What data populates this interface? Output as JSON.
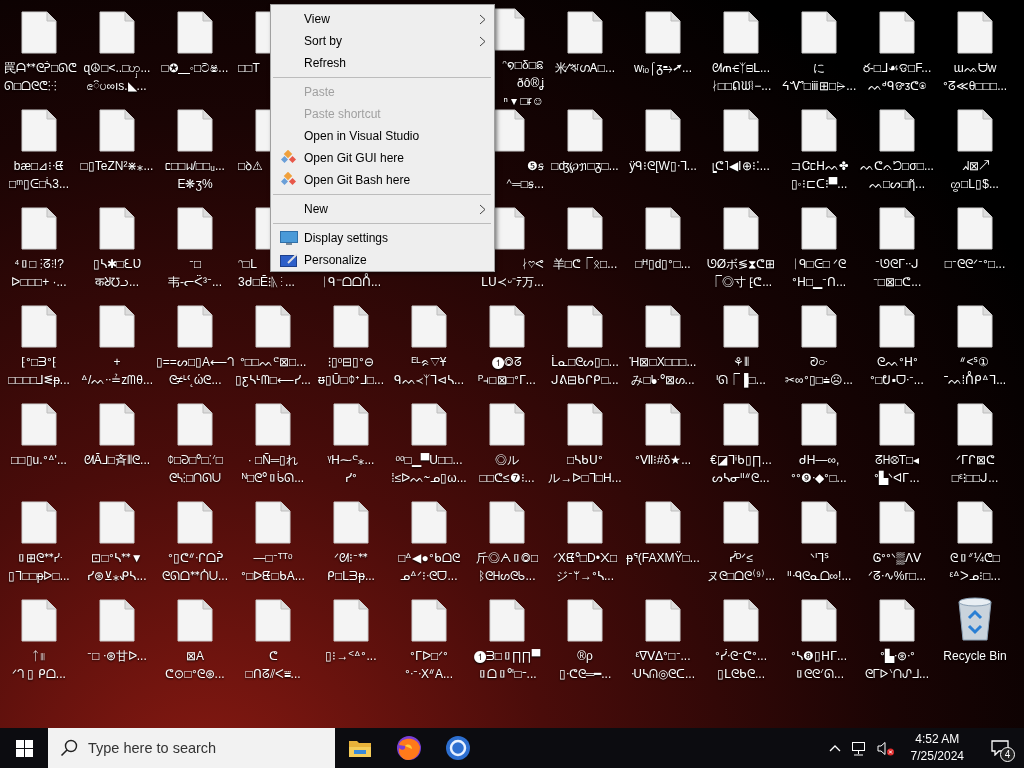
{
  "desktop": {
    "rows": [
      [
        {
          "kind": "file-left",
          "lines": [
            "罠ᗩᕯᘓᕉ□ᘏᕦ",
            "ᘏ□ᗝᘓᕦ⁝ᐧ⁝"
          ]
        },
        {
          "kind": "file",
          "lines": [
            "ɋ☮□<..□ၯ...",
            "ၕ៝ပ∞ıs.◣..."
          ]
        },
        {
          "kind": "file",
          "lines": [
            "□✪▁◦□ටෂ..."
          ]
        },
        {
          "kind": "file-left",
          "lines": [
            "□□T"
          ]
        },
        {
          "kind": "hidden"
        },
        {
          "kind": "hidden"
        },
        {
          "kind": "file-right",
          "lines": [
            "ᵔ໑□δ□ଛ",
            "ðô®ʝ",
            "ⁿ ▾ □ᵲ☺"
          ]
        },
        {
          "kind": "file",
          "lines": [
            "米∕ঋഗᎪ□..."
          ]
        },
        {
          "kind": "file",
          "lines": [
            "wᵢₒ⌠ᵹ⥱➚..."
          ]
        },
        {
          "kind": "file",
          "lines": [
            "ᘛጠ⋲ᛉ⊟ᒪ...",
            "ᛅ□□ᕠᙎ⦚−..."
          ]
        },
        {
          "kind": "file",
          "lines": [
            "に",
            "ᔦᏉ□ⅲ⊞□⩥..."
          ]
        },
        {
          "kind": "file",
          "lines": [
            "ర-□ᒧ☙ଡ□F...",
            "ᨓᒄᑫଙᴣᕦ⍟"
          ]
        },
        {
          "kind": "file",
          "lines": [
            "ɯᨕᗨw",
            "ᐤᘔ≪θ□□□..."
          ]
        }
      ],
      [
        {
          "kind": "file",
          "lines": [
            "bæ□⊿⁝ᐧᘀ",
            "□ᵐ▯ᕮ□ᓵ3..."
          ]
        },
        {
          "kind": "file",
          "lines": [
            "□▯TeZN²⋇⁎..."
          ]
        },
        {
          "kind": "file",
          "lines": [
            "ᥴ□□ᥕ/□□ᵤ...",
            "E❋ʒ%"
          ]
        },
        {
          "kind": "file-left",
          "lines": [
            "□ꝺ⚠"
          ]
        },
        {
          "kind": "hidden"
        },
        {
          "kind": "hidden"
        },
        {
          "kind": "file-right",
          "lines": [
            "❺ꞩ",
            "ᣔ═□ꞩ..."
          ]
        },
        {
          "kind": "file",
          "lines": [
            "□ʤ℘ᥟ□ᵹ□..."
          ]
        },
        {
          "kind": "file",
          "lines": [
            "ӱᑫ⁝ᘓ[W▯ᐧᒣ..."
          ]
        },
        {
          "kind": "file",
          "lines": [
            "ᥧᕦ˥◀Ⅰ⊕⁝⁚..."
          ]
        },
        {
          "kind": "file",
          "lines": [
            "コᏣᥴᕼᨓ✤",
            "▯◦⁝⊏ᑕ⁝▀..."
          ]
        },
        {
          "kind": "file",
          "lines": [
            "ᨓᕦᨊᘤ□σ□...",
            "ᨓ□ᔕ□ῆ..."
          ]
        },
        {
          "kind": "file",
          "lines": [
            "ᖽ⊠↗",
            "ᦛ□ᒪ▯$..."
          ]
        }
      ],
      [
        {
          "kind": "file",
          "lines": [
            "⁴▯□ ⁝ᘔ⫶!?",
            "ᐅ□□□+ ·..."
          ]
        },
        {
          "kind": "file",
          "lines": [
            "▯ᓴ✱□ᘍƲ",
            "कᖈ℧ᓗ..."
          ]
        },
        {
          "kind": "file",
          "lines": [
            "ᐨ□",
            "韦-ᓕᑈ³ᐨ..."
          ]
        },
        {
          "kind": "file-left",
          "lines": [
            "ᵔ□ᒪ",
            "3ᑯ□Ē⁝ᚣ⁝..."
          ]
        },
        {
          "kind": "file-lower",
          "lines": [
            "ᛁᑫ⁻ᗝᗝᑍ..."
          ]
        },
        {
          "kind": "hidden"
        },
        {
          "kind": "file-right",
          "lines": [
            "ᛅ♡ᕙ",
            "ᒪᑌ≺ᵕ⁻ﾃ万..."
          ]
        },
        {
          "kind": "file",
          "lines": [
            "羊□ᕦ⎾ᛟ□..."
          ]
        },
        {
          "kind": "file",
          "lines": [
            "□ᴴ▯d▯ᐤ□..."
          ]
        },
        {
          "kind": "file",
          "lines": [
            "ᘎØボ≶⧗ᕦ⊞",
            "⎾◎寸 ⁅ᕦ..."
          ]
        },
        {
          "kind": "file",
          "lines": [
            "ᛁᑫ□ᕮ□ ᐟᘓ",
            "ᐤᕼ□▁ᐨᑎ..."
          ]
        },
        {
          "kind": "file",
          "lines": [
            "ᐨᘎᘓᒥᐧᐧᒍ",
            "ᐨ□⊠□ᕦ..."
          ]
        },
        {
          "kind": "file",
          "lines": [
            "□ᐨᘓᘓᐟᐨᐤ□..."
          ]
        }
      ],
      [
        {
          "kind": "file",
          "lines": [
            "⁅ᐤ□ᗱᐤ⁅",
            "□□□□⅃ᓬᵽ..."
          ]
        },
        {
          "kind": "file",
          "lines": [
            "+",
            "ᐞ/ᨓᐧᐧ≟zᗰθ..."
          ]
        },
        {
          "kind": "file",
          "lines": [
            "▯==ᔕ□▯A⟵ᘃ",
            "ᘓ≠ᒻᒼ˛ώᘓ..."
          ]
        },
        {
          "kind": "file",
          "lines": [
            "ᐤ□□ᨓᕪ⊠□...",
            "▯ƹᓴᒻᗰ□⟵ᓯ..."
          ]
        },
        {
          "kind": "file",
          "lines": [
            "⁝▯ᵒ⊟▯ᐤ⊖",
            "ᵿ▯Ū□ᛰᕀᒧ□..."
          ]
        },
        {
          "kind": "file",
          "lines": [
            "ᴱᴸᨑ▽Ұ",
            "ᑫᨓ≺ᛉᒣ⊲ᓴ..."
          ]
        },
        {
          "kind": "file",
          "lines": [
            "❶◎ᘔ",
            "ᴾ⫞□⊠□ᐤᒥ..."
          ]
        },
        {
          "kind": "file",
          "lines": [
            "ᒫᓇ□ᘓᔕ▯□...",
            "ᒍᕕ⊟ᑲᒋᑭ□..."
          ]
        },
        {
          "kind": "file",
          "lines": [
            "Ἡ⊠□X□□□...",
            "み□ᖲᐧᐤ⊠ᔕ..."
          ]
        },
        {
          "kind": "file",
          "lines": [
            "⚘⦀",
            "ᑊᘏ⎾▐□..."
          ]
        },
        {
          "kind": "file",
          "lines": [
            "ᘑ○ᐧ",
            "✂∞ᐤ▯□⩧☹..."
          ]
        },
        {
          "kind": "file",
          "lines": [
            "ᘓᨓᐤᕼᐤ",
            "ᐤ□ᕞ▪ᗜᐧᐨ..."
          ]
        },
        {
          "kind": "file",
          "lines": [
            "ᐥ<ᔆ①",
            "⁻ᨓ⁞ᑍᑭᐞᒣ..."
          ]
        }
      ],
      [
        {
          "kind": "file",
          "lines": [
            "□□▯u.ᐤᐞ'..."
          ]
        },
        {
          "kind": "file",
          "lines": [
            "ᘛĀ⅃□斉⦀ᘓ..."
          ]
        },
        {
          "kind": "file",
          "lines": [
            "ᛰ□ᘒ□ᐤ□⁚ᐟ□",
            "ᘓᓴ⁝□ᑎᘏᑌ"
          ]
        },
        {
          "kind": "file",
          "lines": [
            "· □Ñ═▯れ",
            "ᴺ□ᘓᐤ▯ᑳᘏ..."
          ]
        },
        {
          "kind": "file",
          "lines": [
            "ᵞᕼ⁓ᕪ⁎...",
            "ᓯᐤ"
          ]
        },
        {
          "kind": "file",
          "lines": [
            "ᵒᵒ□▁▀U□□...",
            "⁞≤ᐅᨓ⁓ᓄ▯ω..."
          ]
        },
        {
          "kind": "file",
          "lines": [
            "◎ル",
            "□□ᕦ≤❼⁝..."
          ]
        },
        {
          "kind": "file",
          "lines": [
            "□ᓴᑲᑌᐤ",
            "ル→ᐅ□ᒣ□H..."
          ]
        },
        {
          "kind": "file",
          "lines": [
            "ᐤⅦ⁝#δ★..."
          ]
        },
        {
          "kind": "file",
          "lines": [
            "€◪ᒣⁱᑲ▯∏...",
            "ᔕᓴᓂᐦᐥᘓ..."
          ]
        },
        {
          "kind": "file",
          "lines": [
            "ᑯH—∞,",
            "ᐤᐤ❾ᐧ◆ᐤ□..."
          ]
        },
        {
          "kind": "file",
          "lines": [
            "ᘔᕼ⊗T□◂",
            "ᐤ▙ᐠᐊᒥ..."
          ]
        },
        {
          "kind": "file",
          "lines": [
            "ᐟᒥᒋ⊠ᕦ",
            "□ᵋ⁝□□ᒍ..."
          ]
        }
      ],
      [
        {
          "kind": "file",
          "lines": [
            "▯⊞ᘓᕯᓯᐧ",
            "▯ᒣ□□ᵽᐅ□..."
          ]
        },
        {
          "kind": "file",
          "lines": [
            "⊡□ᐤᓴᕯ▼",
            "ᓯ⊛⊻⁎ᕵᓴ..."
          ]
        },
        {
          "kind": "file",
          "lines": [
            "ᐤ▯ᕦᐥᐧᒋᗝᕉ",
            "ᘓᘏᗝᕯᑍᑌ..."
          ]
        },
        {
          "kind": "file",
          "lines": [
            "—□ᐨᵀᵀᵒ",
            "ᐤ□ᐅᘀ□ᑲA..."
          ]
        },
        {
          "kind": "file",
          "lines": [
            "ᐟᘛ⁝ᐨᕯ",
            "ᑭ□ᒪᗱᵽ..."
          ]
        },
        {
          "kind": "file",
          "lines": [
            "□ᐞ◀●ᐤᑲᗝᘓ",
            "ᓄᐞᐟ⁝ᐧᘓᗜ..."
          ]
        },
        {
          "kind": "file",
          "lines": [
            "斤◎ᗅ▯◎□",
            "ᛒᘓᕼᔕᘓᑲ..."
          ]
        },
        {
          "kind": "file",
          "lines": [
            "ᐟXᘀᐤ□D•᙭□",
            "ジᐨᛘ→ᐤᓴ..."
          ]
        },
        {
          "kind": "file",
          "lines": [
            "ᵽᕐ(FAXMŸ□..."
          ]
        },
        {
          "kind": "file",
          "lines": [
            "ᓰᴰᐟ≤",
            "ヌᘓ□ᗝᘓ⁽⁹⁾..."
          ]
        },
        {
          "kind": "file",
          "lines": [
            "ᐠᑊᒣᔆ",
            "ᐦᑴᘓᓇᗝ∞!..."
          ]
        },
        {
          "kind": "file",
          "lines": [
            "Ꮆᐤᐤᐠ▒ᐱᐯ",
            "ᐟᘔᐧ∿%ᴦ□..."
          ]
        },
        {
          "kind": "file",
          "lines": [
            "ᘓ▯ᐥ¼ᕦ□",
            "ᵋᐞᐳᓄ⁝□..."
          ]
        }
      ],
      [
        {
          "kind": "file",
          "lines": [
            "ᛏ⦀",
            "ᐟᘃ ▯ ᑭᗝ..."
          ]
        },
        {
          "kind": "file",
          "lines": [
            "ᐨ□ ᐧ⊛甘ᐅ..."
          ]
        },
        {
          "kind": "file",
          "lines": [
            "⊠A",
            "ᕦ⊙□ᐤᘓ⊛..."
          ]
        },
        {
          "kind": "file",
          "lines": [
            "ᕦ",
            "□ᑎᘔ⫽ᐸ⩸..."
          ]
        },
        {
          "kind": "file",
          "lines": [
            "▯⁝→ᑉᐞᐤ..."
          ]
        },
        {
          "kind": "file",
          "lines": [
            "ᐤᒥᐅ□ᐟᐤ",
            "ᐤᐧᐨᐧXᐥA..."
          ]
        },
        {
          "kind": "file",
          "lines": [
            "❶ᗱ□▯∏∏▀",
            "▯ᗝ▯ᐤᑊ□ᐨ..."
          ]
        },
        {
          "kind": "file",
          "lines": [
            "®ρ",
            "▯ᐧᕦᘓ═━..."
          ]
        },
        {
          "kind": "file",
          "lines": [
            "ᵋᐁᐯᐃᐤ□ᐨ...",
            "ᑗᓴᕬ◎ᘓᑕ..."
          ]
        },
        {
          "kind": "file",
          "lines": [
            "ᐤᓰᐧᘓᐨᕦᐤ...",
            "▯ᒪᘓᑲᘓ..."
          ]
        },
        {
          "kind": "file",
          "lines": [
            "ᐤᓴ❽▯ᕼᒥ...",
            "▯ᘓᘓᐟᘏ..."
          ]
        },
        {
          "kind": "file",
          "lines": [
            "ᐤ▙ᐧ⊛ᐧᐤ",
            "ᘓᒥᐅᐠᑎᔑᒧ..."
          ]
        },
        {
          "kind": "recycle-bin",
          "lines": [
            "Recycle Bin"
          ]
        }
      ]
    ]
  },
  "context_menu": [
    {
      "kind": "plain",
      "label": "View",
      "disabled": false,
      "submenu": true
    },
    {
      "kind": "plain",
      "label": "Sort by",
      "disabled": false,
      "submenu": true
    },
    {
      "kind": "plain",
      "label": "Refresh",
      "disabled": false,
      "submenu": false
    },
    {
      "kind": "separator"
    },
    {
      "kind": "plain",
      "label": "Paste",
      "disabled": true,
      "submenu": false
    },
    {
      "kind": "plain",
      "label": "Paste shortcut",
      "disabled": true,
      "submenu": false
    },
    {
      "kind": "plain",
      "label": "Open in Visual Studio",
      "disabled": false,
      "submenu": false
    },
    {
      "kind": "git",
      "label": "Open Git GUI here",
      "disabled": false,
      "submenu": false
    },
    {
      "kind": "git",
      "label": "Open Git Bash here",
      "disabled": false,
      "submenu": false
    },
    {
      "kind": "separator"
    },
    {
      "kind": "plain",
      "label": "New",
      "disabled": false,
      "submenu": true
    },
    {
      "kind": "separator"
    },
    {
      "kind": "screen",
      "label": "Display settings",
      "disabled": false,
      "submenu": false
    },
    {
      "kind": "personalize",
      "label": "Personalize",
      "disabled": false,
      "submenu": false
    }
  ],
  "taskbar": {
    "search": {
      "placeholder": "Type here to search"
    },
    "apps": [
      {
        "kind": "folder"
      },
      {
        "kind": "fox"
      },
      {
        "kind": "ring"
      }
    ],
    "clock": {
      "time": "4:52 AM",
      "date": "7/25/2024"
    },
    "notifications": {
      "count": "4"
    }
  }
}
